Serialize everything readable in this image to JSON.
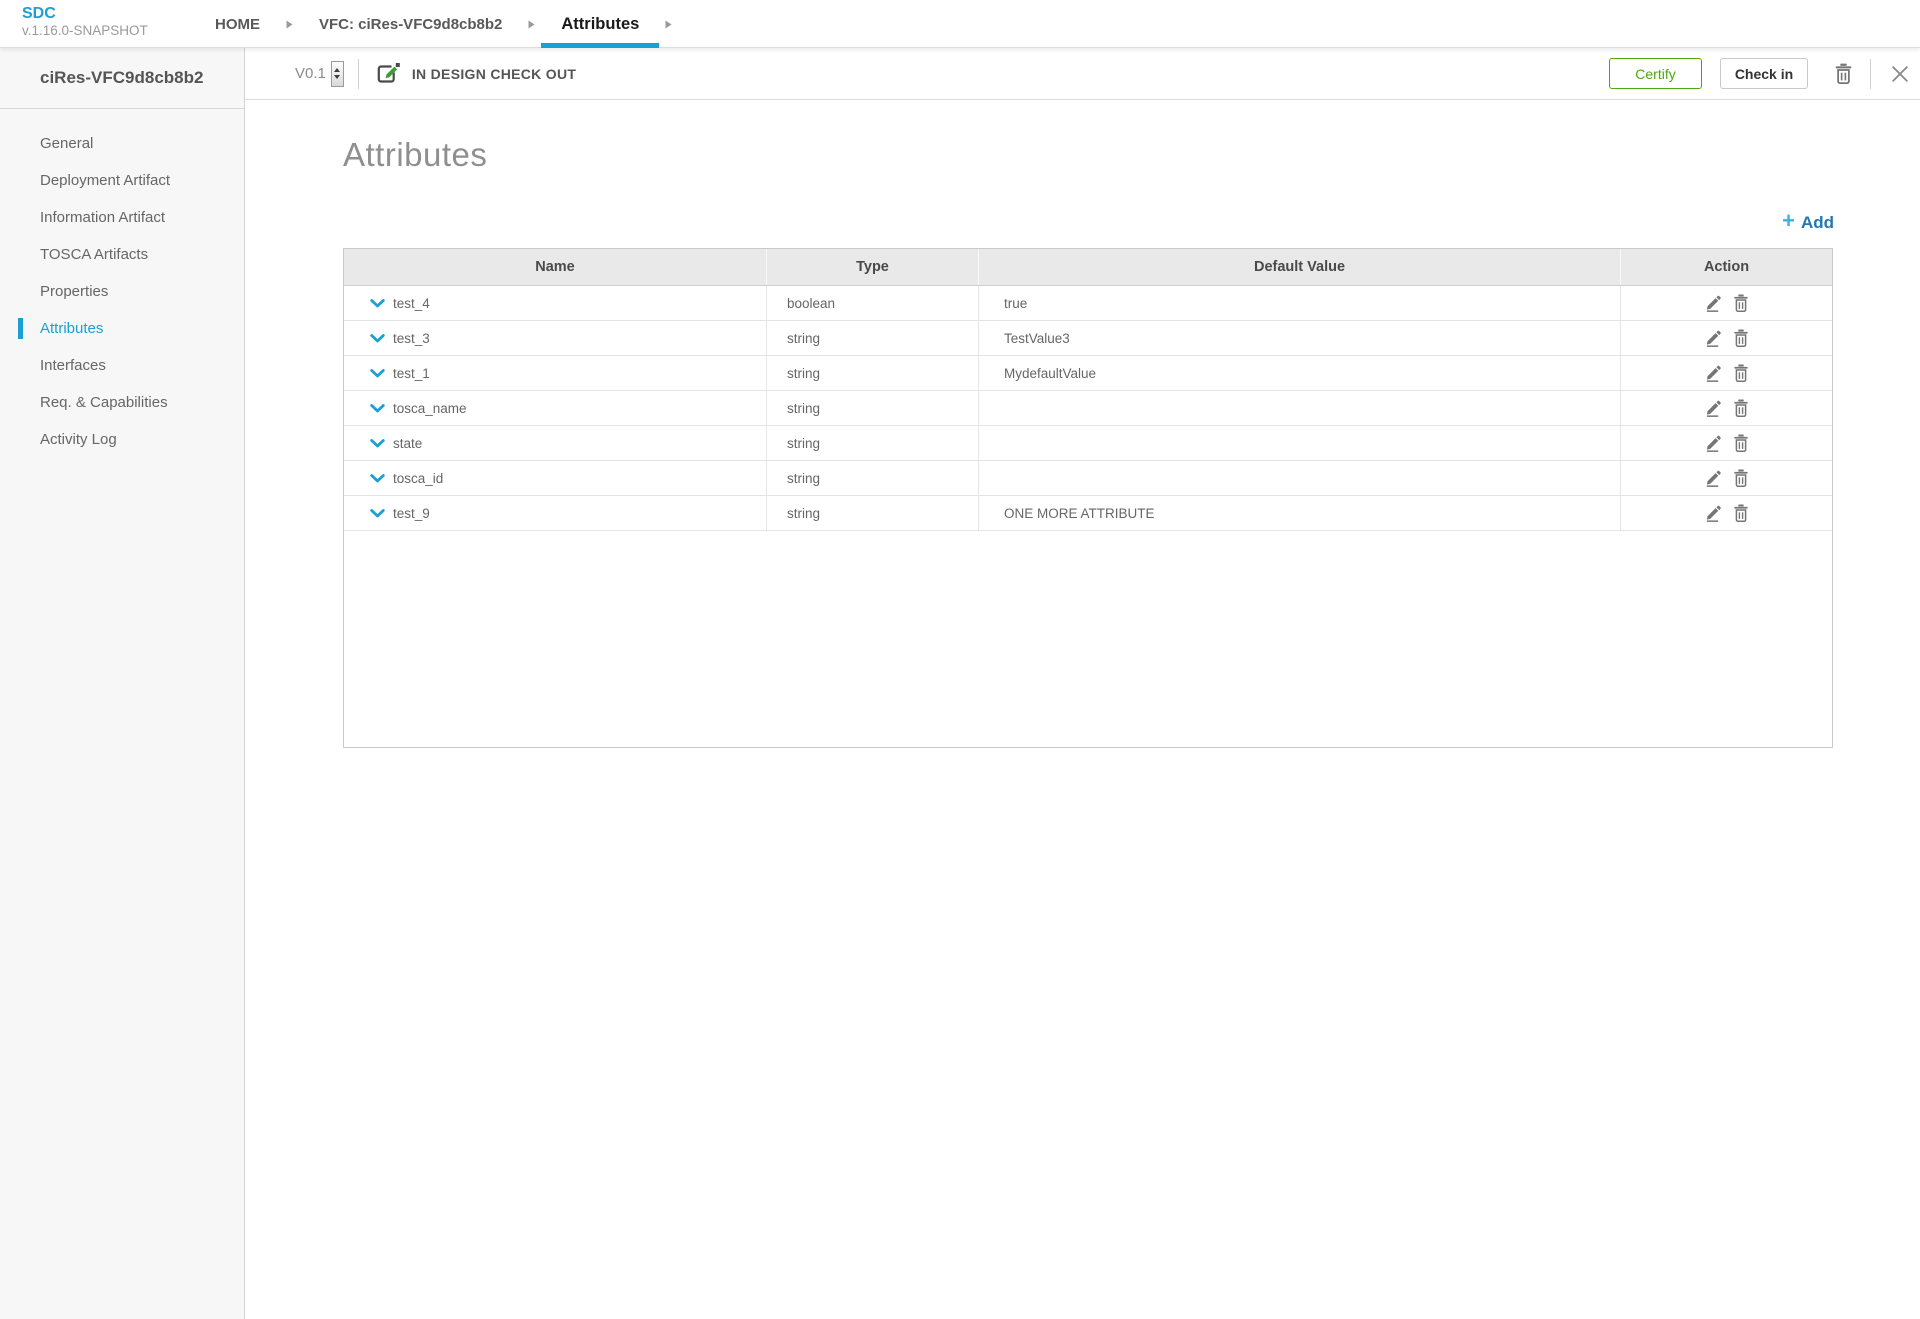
{
  "header": {
    "logo": {
      "title": "SDC",
      "version": "v.1.16.0-SNAPSHOT"
    },
    "breadcrumbs": [
      {
        "label": "HOME",
        "active": false
      },
      {
        "label": "VFC: ciRes-VFC9d8cb8b2",
        "active": false
      },
      {
        "label": "Attributes",
        "active": true
      }
    ]
  },
  "toolbar": {
    "version": "V0.1",
    "status": "IN DESIGN CHECK OUT",
    "certify_label": "Certify",
    "checkin_label": "Check in"
  },
  "sidebar": {
    "title": "ciRes-VFC9d8cb8b2",
    "items": [
      {
        "label": "General",
        "active": false
      },
      {
        "label": "Deployment Artifact",
        "active": false
      },
      {
        "label": "Information Artifact",
        "active": false
      },
      {
        "label": "TOSCA Artifacts",
        "active": false
      },
      {
        "label": "Properties",
        "active": false
      },
      {
        "label": "Attributes",
        "active": true
      },
      {
        "label": "Interfaces",
        "active": false
      },
      {
        "label": "Req. & Capabilities",
        "active": false
      },
      {
        "label": "Activity Log",
        "active": false
      }
    ]
  },
  "main": {
    "title": "Attributes",
    "add_label": "Add",
    "table": {
      "columns": [
        "Name",
        "Type",
        "Default Value",
        "Action"
      ],
      "rows": [
        {
          "name": "test_4",
          "type": "boolean",
          "default_value": "true"
        },
        {
          "name": "test_3",
          "type": "string",
          "default_value": "TestValue3"
        },
        {
          "name": "test_1",
          "type": "string",
          "default_value": "MydefaultValue"
        },
        {
          "name": "tosca_name",
          "type": "string",
          "default_value": ""
        },
        {
          "name": "state",
          "type": "string",
          "default_value": ""
        },
        {
          "name": "tosca_id",
          "type": "string",
          "default_value": ""
        },
        {
          "name": "test_9",
          "type": "string",
          "default_value": "ONE MORE ATTRIBUTE"
        }
      ]
    }
  },
  "colors": {
    "accent_blue": "#1ba0d5",
    "certify_green": "#4ca810",
    "icon_gray": "#757575"
  }
}
